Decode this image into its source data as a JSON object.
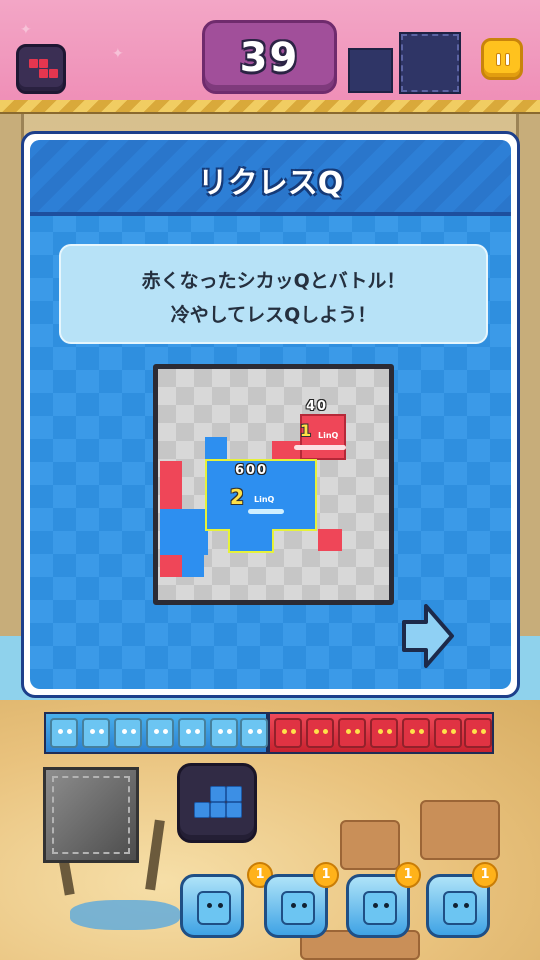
{
  "hud": {
    "counter": "39",
    "menu_icon": "tetromino-icon",
    "pause_icon": "pause-icon"
  },
  "tutorial": {
    "title": "リクレスQ",
    "description_lines": [
      "赤くなったシカッQとバトル！",
      "冷やしてレスQしよう！"
    ],
    "demo": {
      "blue_score": "600",
      "blue_rank": "2",
      "blue_tag": "LinQ",
      "red_score": "40",
      "red_rank": "1",
      "red_tag": "LinQ"
    },
    "next_icon": "arrow-right-icon"
  },
  "skills": {
    "badges": [
      "1",
      "1",
      "1",
      "1"
    ]
  },
  "colors": {
    "team_blue": "#2d8ff0",
    "team_red": "#ef4658",
    "modal_blue": "#2e8fe0",
    "accent_yellow": "#ffc21e"
  }
}
